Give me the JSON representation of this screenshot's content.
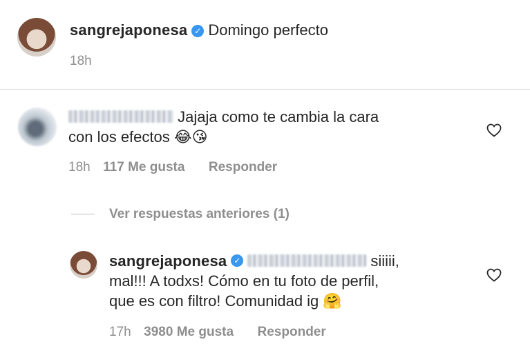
{
  "post": {
    "username": "sangrejaponesa",
    "caption": "Domingo perfecto",
    "time": "18h"
  },
  "comment1": {
    "text_line1": "Jajaja como te cambia la cara",
    "text_line2": "con los efectos",
    "emoji1": "😂",
    "emoji2": "😘",
    "time": "18h",
    "likes": "117 Me gusta",
    "reply": "Responder"
  },
  "replies_toggle": "Ver respuestas anteriores (1)",
  "reply1": {
    "username": "sangrejaponesa",
    "text_line1": "siiiii,",
    "text_line2": "mal!!! A todxs! Cómo en tu foto de perfil,",
    "text_line3": "que es con filtro! Comunidad ig",
    "emoji": "🤗",
    "time": "17h",
    "likes": "3980 Me gusta",
    "reply": "Responder"
  },
  "icons": {
    "verified": "verified-badge-icon",
    "heart": "heart-outline-icon"
  },
  "colors": {
    "verified_blue": "#3897f0",
    "meta_gray": "#8e8e8e",
    "text": "#262626"
  }
}
